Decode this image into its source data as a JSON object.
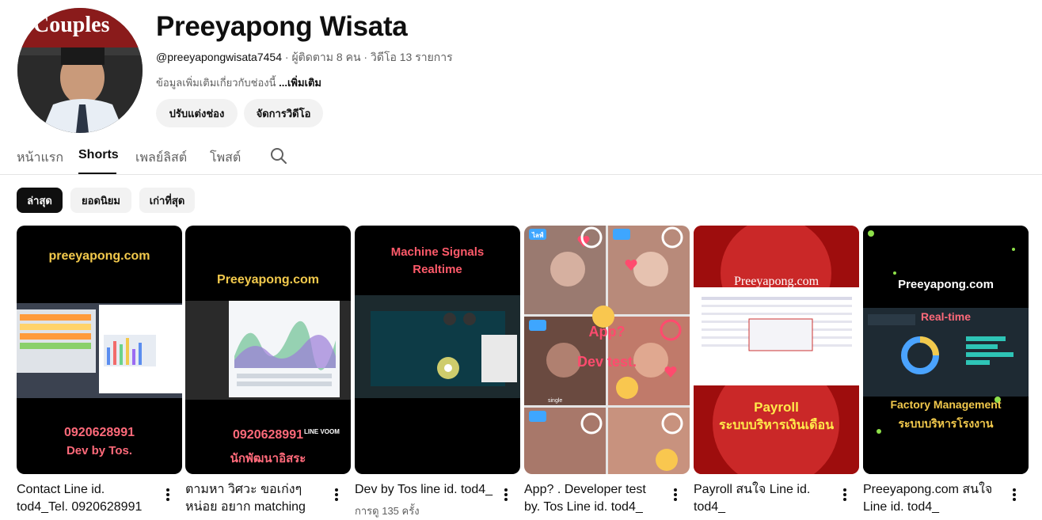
{
  "channel": {
    "name": "Preeyapong Wisata",
    "handle": "@preeyapongwisata7454",
    "subscribers": "ผู้ติดตาม 8 คน",
    "videos": "วิดีโอ 13 รายการ",
    "separator": "·",
    "description": "ข้อมูลเพิ่มเติมเกี่ยวกับช่องนี้",
    "more_label": "...เพิ่มเติม",
    "avatar_text": "Couples"
  },
  "actions": {
    "customize": "ปรับแต่งช่อง",
    "manage": "จัดการวิดีโอ"
  },
  "tabs": [
    {
      "label": "หน้าแรก"
    },
    {
      "label": "Shorts"
    },
    {
      "label": "เพลย์ลิสต์"
    },
    {
      "label": "โพสต์"
    }
  ],
  "chips": [
    {
      "label": "ล่าสุด"
    },
    {
      "label": "ยอดนิยม"
    },
    {
      "label": "เก่าที่สุด"
    }
  ],
  "shorts": [
    {
      "title": "Contact Line id. tod4_Tel. 0920628991",
      "views": "",
      "thumb_top": "preeyapong.com",
      "thumb_bottom1": "0920628991",
      "thumb_bottom2": "Dev by Tos."
    },
    {
      "title": "ตามหา วิศวะ ขอเก่งๆ หน่อย อยาก matching",
      "views": "",
      "thumb_top": "Preeyapong.com",
      "thumb_bottom1": "0920628991",
      "thumb_bottom2": "นักพัฒนาอิสระ",
      "thumb_badge": "LINE VOOM"
    },
    {
      "title": "Dev by Tos line id. tod4_",
      "views": "การดู 135 ครั้ง",
      "thumb_top1": "Machine Signals",
      "thumb_top2": "Realtime"
    },
    {
      "title": "App? . Developer test by. Tos Line id. tod4_",
      "views": "",
      "thumb_mid1": "App?",
      "thumb_mid2": "Dev test.",
      "thumb_live": "ไลฟ์",
      "thumb_single": "single"
    },
    {
      "title": "Payroll สนใจ Line id. tod4_",
      "views": "",
      "thumb_top": "Preeyapong.com",
      "thumb_bottom1": "Payroll",
      "thumb_bottom2": "ระบบบริหารเงินเดือน"
    },
    {
      "title": "Preeyapong.com สนใจ Line id. tod4_",
      "views": "",
      "thumb_top": "Preeyapong.com",
      "thumb_mid": "Real-time",
      "thumb_bottom1": "Factory Management",
      "thumb_bottom2": "ระบบบริหารโรงงาน"
    }
  ],
  "colors": {
    "text_primary": "#0f0f0f",
    "text_secondary": "#606060",
    "chip_bg": "#f2f2f2",
    "chip_selected_bg": "#0f0f0f"
  }
}
